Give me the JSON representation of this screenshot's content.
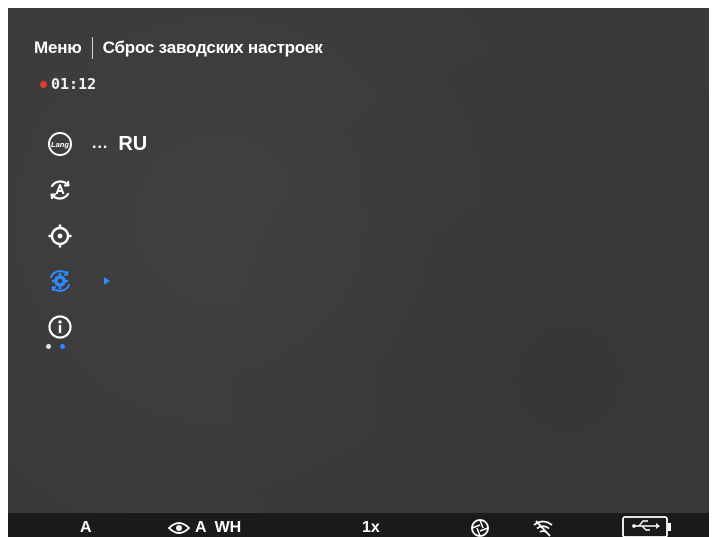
{
  "header": {
    "title": "Меню",
    "subtitle": "Сброс заводских настроек"
  },
  "recording": {
    "time": "01:12",
    "dot_color": "#e53935"
  },
  "menu": {
    "items": [
      {
        "icon": "language-icon",
        "icon_text": "Lang",
        "value_prefix": "...",
        "value": "RU"
      },
      {
        "icon": "auto-rotate-icon"
      },
      {
        "icon": "crosshair-icon"
      },
      {
        "icon": "gear-icon",
        "selected": true,
        "has_arrow": true
      },
      {
        "icon": "info-icon"
      }
    ],
    "accent_color": "#2e8bff",
    "pager": {
      "pages": 2,
      "current": 2
    }
  },
  "statusbar": {
    "mode_label": "A",
    "view_mode": "A",
    "view_preset": "WH",
    "zoom": "1x",
    "icons": [
      "eye-icon",
      "aperture-icon",
      "wifi-off-icon",
      "usb-battery-icon"
    ]
  }
}
